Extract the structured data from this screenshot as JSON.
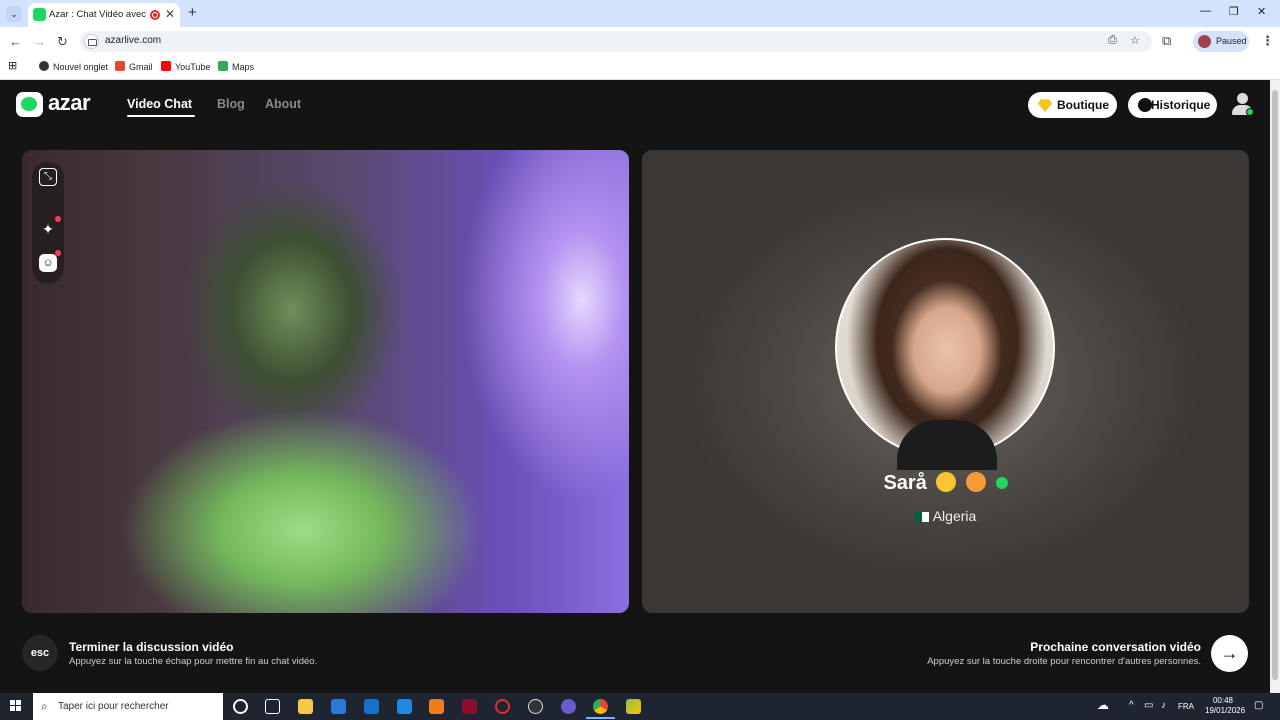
{
  "browser": {
    "tab_title": "Azar : Chat Vidéo avec de n",
    "url": "azarlive.com",
    "profile_label": "Paused",
    "bookmarks": [
      "Nouvel onglet",
      "Gmail",
      "YouTube",
      "Maps"
    ]
  },
  "site": {
    "logo": "azar",
    "nav": [
      "Video Chat",
      "Blog",
      "About"
    ],
    "shop_label": "Boutique",
    "history_label": "Historique"
  },
  "remote": {
    "name": "Sarå",
    "country": "Algeria"
  },
  "controls": {
    "esc_key": "esc",
    "end_title": "Terminer la discussion vidéo",
    "end_sub": "Appuyez sur la touche échap pour mettre fin au chat vidéo.",
    "next_title": "Prochaine conversation vidéo",
    "next_sub": "Appuyez sur la touche droite pour rencontrer d'autres personnes."
  },
  "taskbar": {
    "search_placeholder": "Taper ici pour rechercher",
    "lang": "FRA",
    "time": "00:48",
    "date": "19/01/2026"
  },
  "colors": {
    "accent": "#1ed760",
    "page_bg": "#141414",
    "tab_bg": "#d3e3fd"
  }
}
